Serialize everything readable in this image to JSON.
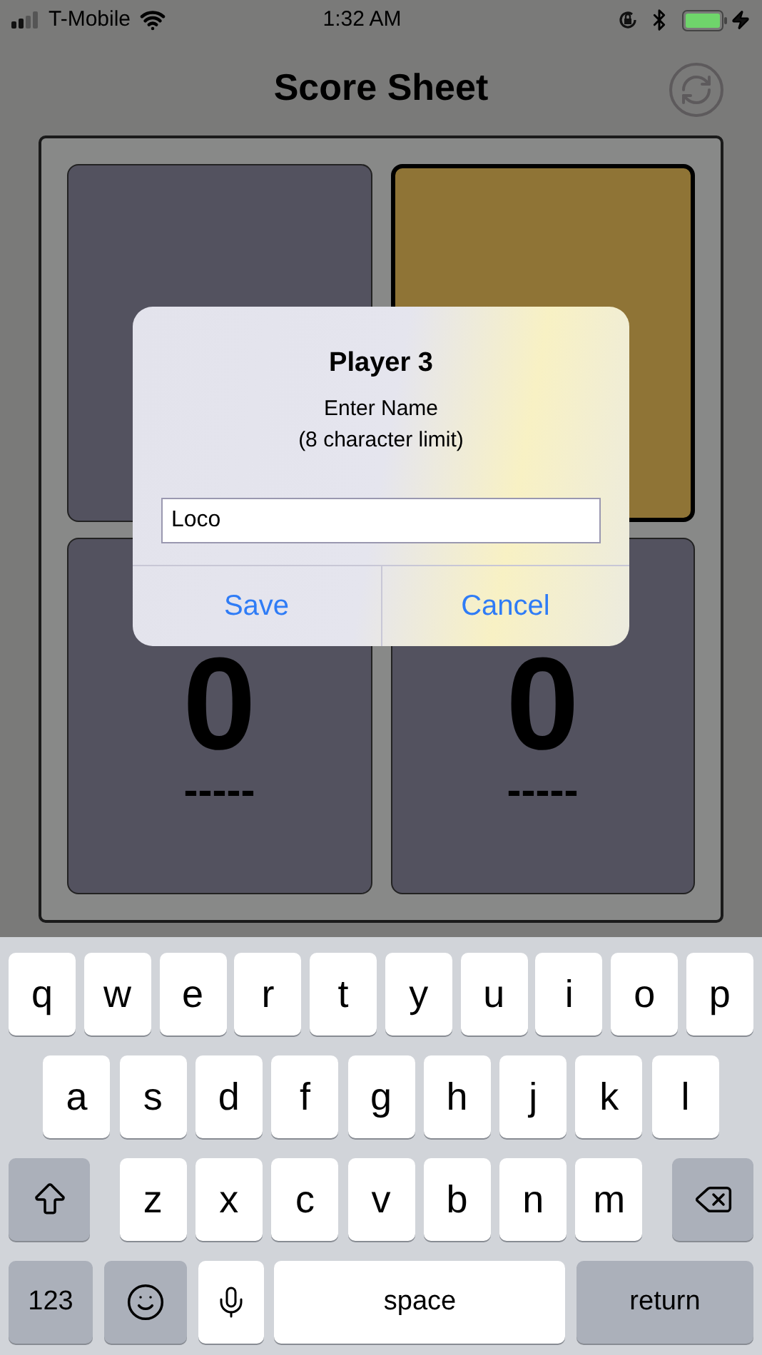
{
  "status_bar": {
    "carrier": "T-Mobile",
    "time": "1:32 AM"
  },
  "header": {
    "title": "Score Sheet"
  },
  "cards": [
    {
      "selected": false
    },
    {
      "selected": true
    },
    {
      "score": "0",
      "name": "-----",
      "selected": false
    },
    {
      "score": "0",
      "name": "-----",
      "selected": false
    }
  ],
  "dialog": {
    "title": "Player 3",
    "message": "Enter Name",
    "note": "(8 character limit)",
    "value": "Loco",
    "buttons": [
      "Save",
      "Cancel"
    ]
  },
  "keyboard": {
    "rows": [
      {
        "keys": [
          {
            "kind": "letter",
            "label": "q"
          },
          {
            "kind": "letter",
            "label": "w"
          },
          {
            "kind": "letter",
            "label": "e"
          },
          {
            "kind": "letter",
            "label": "r"
          },
          {
            "kind": "letter",
            "label": "t"
          },
          {
            "kind": "letter",
            "label": "y"
          },
          {
            "kind": "letter",
            "label": "u"
          },
          {
            "kind": "letter",
            "label": "i"
          },
          {
            "kind": "letter",
            "label": "o"
          },
          {
            "kind": "letter",
            "label": "p"
          }
        ]
      },
      {
        "keys": [
          {
            "kind": "letter",
            "label": "a"
          },
          {
            "kind": "letter",
            "label": "s"
          },
          {
            "kind": "letter",
            "label": "d"
          },
          {
            "kind": "letter",
            "label": "f"
          },
          {
            "kind": "letter",
            "label": "g"
          },
          {
            "kind": "letter",
            "label": "h"
          },
          {
            "kind": "letter",
            "label": "j"
          },
          {
            "kind": "letter",
            "label": "k"
          },
          {
            "kind": "letter",
            "label": "l"
          }
        ]
      },
      {
        "keys": [
          {
            "kind": "shift"
          },
          {
            "kind": "letter",
            "label": "z"
          },
          {
            "kind": "letter",
            "label": "x"
          },
          {
            "kind": "letter",
            "label": "c"
          },
          {
            "kind": "letter",
            "label": "v"
          },
          {
            "kind": "letter",
            "label": "b"
          },
          {
            "kind": "letter",
            "label": "n"
          },
          {
            "kind": "letter",
            "label": "m"
          },
          {
            "kind": "delete"
          }
        ]
      },
      {
        "keys": [
          {
            "kind": "mode",
            "label": "123"
          },
          {
            "kind": "emoji"
          },
          {
            "kind": "mic"
          },
          {
            "kind": "space",
            "label": "space"
          },
          {
            "kind": "return",
            "label": "return"
          }
        ]
      }
    ]
  }
}
